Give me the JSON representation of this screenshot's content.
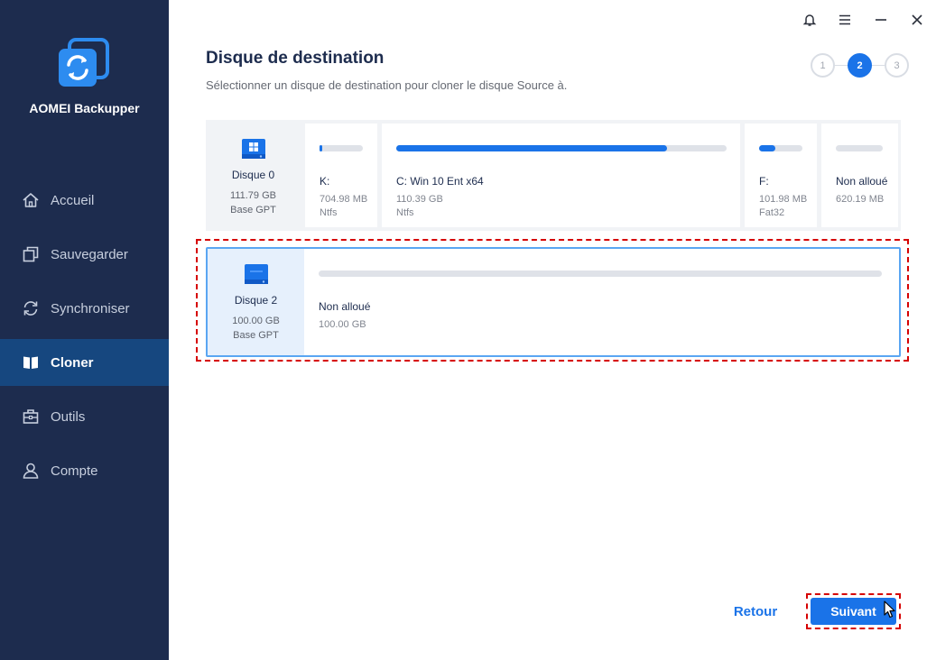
{
  "app": {
    "name": "AOMEI Backupper"
  },
  "sidebar": {
    "items": [
      {
        "label": "Accueil",
        "icon": "home-icon"
      },
      {
        "label": "Sauvegarder",
        "icon": "backup-icon"
      },
      {
        "label": "Synchroniser",
        "icon": "sync-icon"
      },
      {
        "label": "Cloner",
        "icon": "clone-icon",
        "active": true
      },
      {
        "label": "Outils",
        "icon": "toolbox-icon"
      },
      {
        "label": "Compte",
        "icon": "user-icon"
      }
    ]
  },
  "header": {
    "title": "Disque de destination",
    "subtitle": "Sélectionner un disque de destination pour cloner le disque Source à."
  },
  "steps": {
    "items": [
      "1",
      "2",
      "3"
    ],
    "current": 2
  },
  "disks": [
    {
      "name": "Disque 0",
      "size": "111.79 GB",
      "type": "Base GPT",
      "selected": false,
      "partitions": [
        {
          "label": "K:",
          "size": "704.98 MB",
          "fs": "Ntfs",
          "used_fraction": 0.06
        },
        {
          "label": "C: Win 10 Ent x64",
          "size": "110.39 GB",
          "fs": "Ntfs",
          "used_fraction": 0.82
        },
        {
          "label": "F:",
          "size": "101.98 MB",
          "fs": "Fat32",
          "used_fraction": 0.38
        },
        {
          "label": "Non alloué",
          "size": "620.19 MB",
          "fs": "",
          "used_fraction": 0
        }
      ]
    },
    {
      "name": "Disque 2",
      "size": "100.00 GB",
      "type": "Base GPT",
      "selected": true,
      "partitions": [
        {
          "label": "Non alloué",
          "size": "100.00 GB",
          "fs": "",
          "used_fraction": 0
        }
      ]
    }
  ],
  "footer": {
    "back_label": "Retour",
    "next_label": "Suivant"
  },
  "colors": {
    "sidebar_bg": "#1d2c4e",
    "sidebar_active": "#16477f",
    "accent": "#1a73e8",
    "highlight_border": "#d60000"
  }
}
